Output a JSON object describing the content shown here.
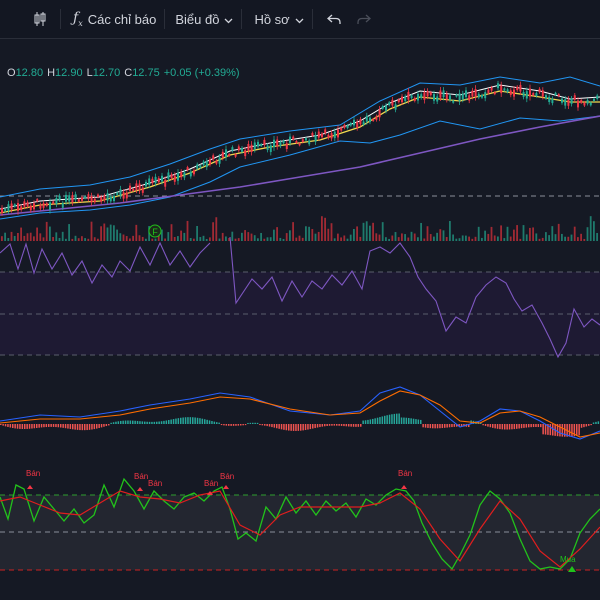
{
  "toolbar": {
    "indicators_label": "Các chỉ báo",
    "chart_label": "Biểu đồ",
    "profile_label": "Hồ sơ"
  },
  "ohlc": {
    "o_key": "O",
    "o_val": "12.80",
    "h_key": "H",
    "h_val": "12.90",
    "l_key": "L",
    "l_val": "12.70",
    "c_key": "C",
    "c_val": "12.75",
    "change": "+0.05 (+0.39%)"
  },
  "markers": {
    "f_label": "F",
    "sell_label": "Bán",
    "buy_label": "Mua"
  },
  "colors": {
    "background": "#151924",
    "up": "#22ab94",
    "down": "#f23645",
    "macd_line": "#2962ff",
    "signal_line": "#ff6d00",
    "rsi_line": "#7e57c2",
    "stoch_k": "#22c21b",
    "stoch_d": "#e01e1e",
    "ma_long": "#7e57c2",
    "bollinger": "#2196f3"
  },
  "icons": [
    "candlestick-icon",
    "fx-icon",
    "undo-icon",
    "redo-icon",
    "chevron-down-icon"
  ]
}
